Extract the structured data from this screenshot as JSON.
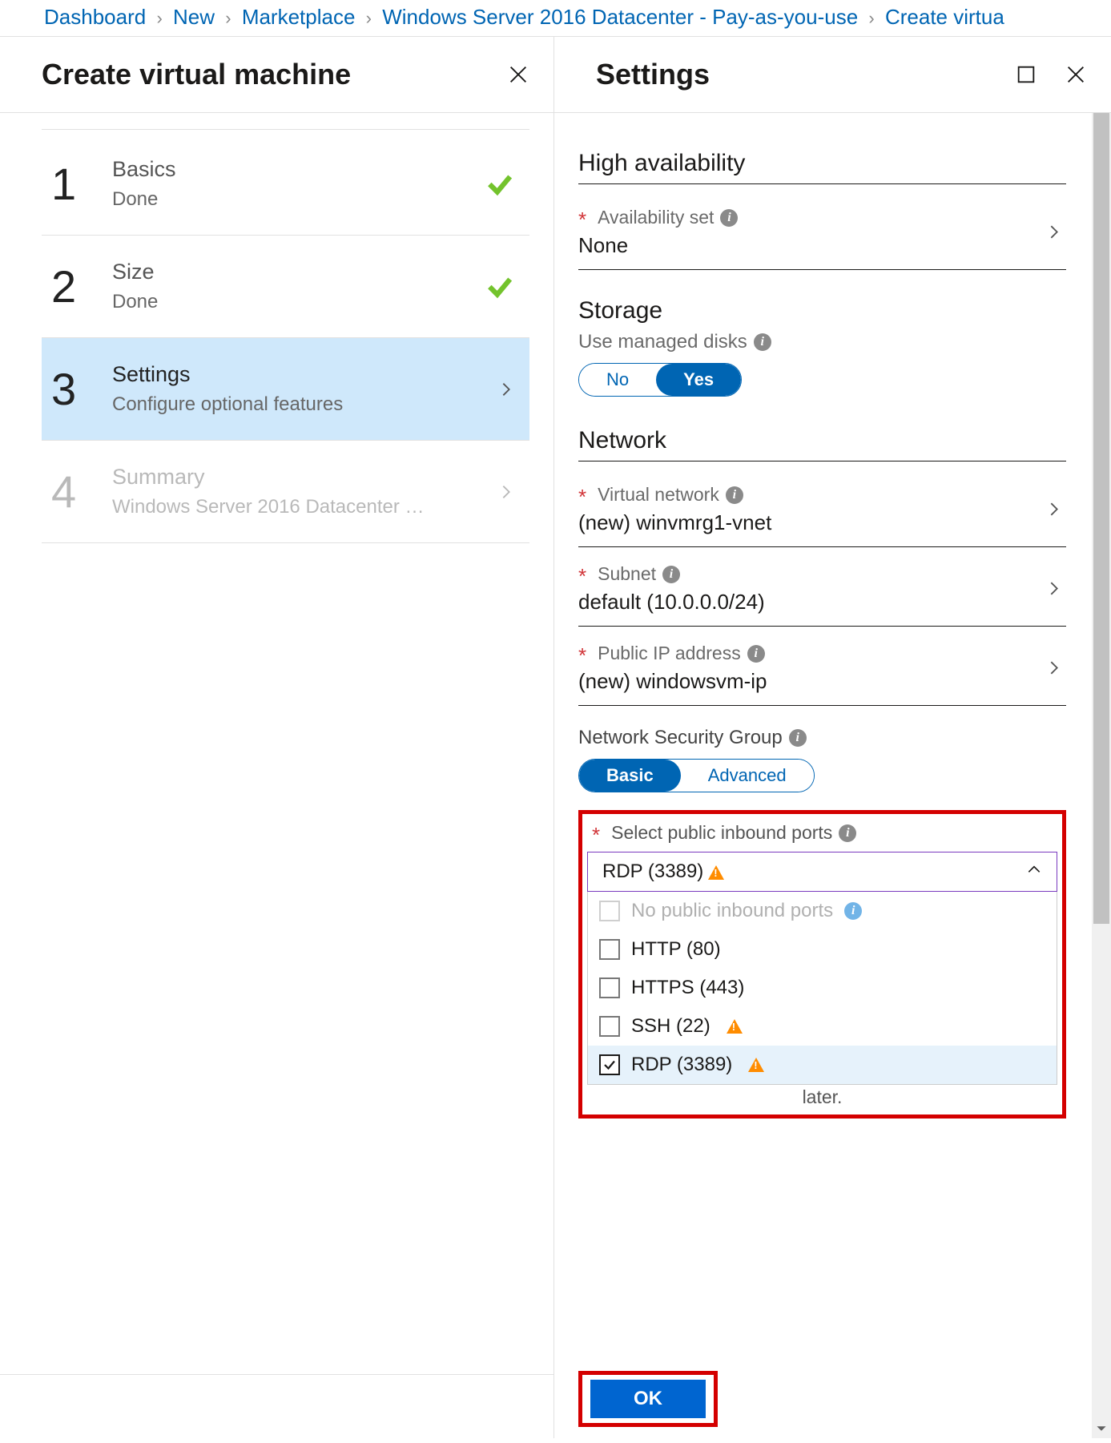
{
  "breadcrumb": [
    "Dashboard",
    "New",
    "Marketplace",
    "Windows Server 2016 Datacenter - Pay-as-you-use",
    "Create virtua"
  ],
  "left": {
    "title": "Create virtual machine",
    "steps": [
      {
        "num": "1",
        "title": "Basics",
        "sub": "Done",
        "state": "done"
      },
      {
        "num": "2",
        "title": "Size",
        "sub": "Done",
        "state": "done"
      },
      {
        "num": "3",
        "title": "Settings",
        "sub": "Configure optional features",
        "state": "active"
      },
      {
        "num": "4",
        "title": "Summary",
        "sub": "Windows Server 2016 Datacenter …",
        "state": "disabled"
      }
    ]
  },
  "right": {
    "title": "Settings",
    "high_availability": {
      "heading": "High availability",
      "availability_set_label": "Availability set",
      "availability_set_value": "None"
    },
    "storage": {
      "heading": "Storage",
      "managed_label": "Use managed disks",
      "no": "No",
      "yes": "Yes"
    },
    "network": {
      "heading": "Network",
      "vnet_label": "Virtual network",
      "vnet_value": "(new) winvmrg1-vnet",
      "subnet_label": "Subnet",
      "subnet_value": "default (10.0.0.0/24)",
      "pip_label": "Public IP address",
      "pip_value": "(new) windowsvm-ip",
      "nsg_label": "Network Security Group",
      "basic": "Basic",
      "advanced": "Advanced",
      "ports_label": "Select public inbound ports",
      "ports_selected": "RDP (3389)",
      "ports_options": [
        {
          "label": "No public inbound ports",
          "disabled": true,
          "info": true,
          "warn": false
        },
        {
          "label": "HTTP (80)",
          "disabled": false,
          "info": false,
          "warn": false
        },
        {
          "label": "HTTPS (443)",
          "disabled": false,
          "info": false,
          "warn": false
        },
        {
          "label": "SSH (22)",
          "disabled": false,
          "info": false,
          "warn": true
        },
        {
          "label": "RDP (3389)",
          "disabled": false,
          "info": false,
          "warn": true,
          "selected": true
        }
      ],
      "later": "later."
    },
    "ok": "OK"
  }
}
